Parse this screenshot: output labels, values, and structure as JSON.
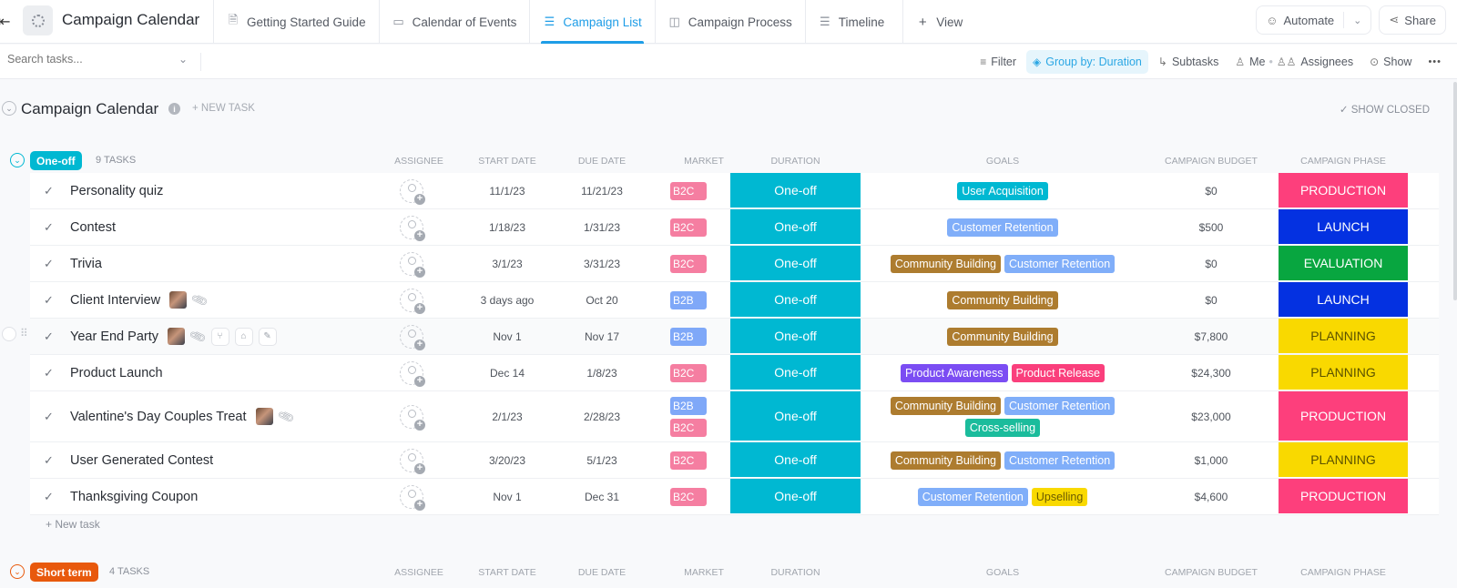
{
  "header": {
    "title": "Campaign Calendar",
    "tabs": [
      {
        "label": "Getting Started Guide",
        "icon": "doc-pin-icon",
        "active": false
      },
      {
        "label": "Calendar of Events",
        "icon": "calendar-pin-icon",
        "active": false
      },
      {
        "label": "Campaign List",
        "icon": "list-icon",
        "active": true
      },
      {
        "label": "Campaign Process",
        "icon": "board-icon",
        "active": false
      },
      {
        "label": "Timeline",
        "icon": "timeline-icon",
        "active": false
      }
    ],
    "add_view_label": "View",
    "automate_label": "Automate",
    "share_label": "Share"
  },
  "toolbar": {
    "search_placeholder": "Search tasks...",
    "filter_label": "Filter",
    "group_by_label": "Group by: Duration",
    "subtasks_label": "Subtasks",
    "me_label": "Me",
    "assignees_label": "Assignees",
    "show_label": "Show",
    "more_label": "•••"
  },
  "list": {
    "title": "Campaign Calendar",
    "new_task_label": "+ NEW TASK",
    "show_closed_label": "SHOW CLOSED"
  },
  "columns": {
    "assignee": "ASSIGNEE",
    "start_date": "START DATE",
    "due_date": "DUE DATE",
    "market": "MARKET",
    "duration": "DURATION",
    "goals": "GOALS",
    "budget": "CAMPAIGN BUDGET",
    "phase": "CAMPAIGN PHASE"
  },
  "colors": {
    "one_off": "#00b8d2",
    "short_term": "#e8590c",
    "b2c": "#f57ea1",
    "b2b": "#7fa8f8",
    "production": "#fd3f7c",
    "launch": "#0431e1",
    "evaluation": "#08a640",
    "planning": "#f9d900",
    "community_building": "#ad7c2f",
    "customer_retention": "#80aef9",
    "user_acquisition": "#00b8d2",
    "cross_selling": "#1bbc9c",
    "product_awareness": "#7b4df3",
    "product_release": "#fa3f7c",
    "upselling": "#f9d900"
  },
  "groups": [
    {
      "name": "One-off",
      "count_label": "9 TASKS",
      "new_task_label": "+ New task",
      "tasks": [
        {
          "name": "Personality quiz",
          "start": "11/1/23",
          "due": "11/21/23",
          "market": [
            "B2C"
          ],
          "duration": "One-off",
          "goals": [
            "User Acquisition"
          ],
          "budget": "$0",
          "phase": "PRODUCTION"
        },
        {
          "name": "Contest",
          "start": "1/18/23",
          "due": "1/31/23",
          "market": [
            "B2C"
          ],
          "duration": "One-off",
          "goals": [
            "Customer Retention"
          ],
          "budget": "$500",
          "phase": "LAUNCH"
        },
        {
          "name": "Trivia",
          "start": "3/1/23",
          "due": "3/31/23",
          "market": [
            "B2C"
          ],
          "duration": "One-off",
          "goals": [
            "Community Building",
            "Customer Retention"
          ],
          "budget": "$0",
          "phase": "EVALUATION"
        },
        {
          "name": "Client Interview",
          "start": "3 days ago",
          "due": "Oct 20",
          "market": [
            "B2B"
          ],
          "duration": "One-off",
          "goals": [
            "Community Building"
          ],
          "budget": "$0",
          "phase": "LAUNCH",
          "has_image": true,
          "has_attachment": true
        },
        {
          "name": "Year End Party",
          "start": "Nov 1",
          "due": "Nov 17",
          "market": [
            "B2B"
          ],
          "duration": "One-off",
          "goals": [
            "Community Building"
          ],
          "budget": "$7,800",
          "phase": "PLANNING",
          "has_image": true,
          "has_attachment": true,
          "hovered": true
        },
        {
          "name": "Product Launch",
          "start": "Dec 14",
          "due": "1/8/23",
          "market": [
            "B2C"
          ],
          "duration": "One-off",
          "goals": [
            "Product Awareness",
            "Product Release"
          ],
          "budget": "$24,300",
          "phase": "PLANNING"
        },
        {
          "name": "Valentine's Day Couples Treat",
          "start": "2/1/23",
          "due": "2/28/23",
          "market": [
            "B2B",
            "B2C"
          ],
          "duration": "One-off",
          "goals": [
            "Community Building",
            "Customer Retention",
            "Cross-selling"
          ],
          "budget": "$23,000",
          "phase": "PRODUCTION",
          "has_image": true,
          "has_attachment": true
        },
        {
          "name": "User Generated Contest",
          "start": "3/20/23",
          "due": "5/1/23",
          "market": [
            "B2C"
          ],
          "duration": "One-off",
          "goals": [
            "Community Building",
            "Customer Retention"
          ],
          "budget": "$1,000",
          "phase": "PLANNING"
        },
        {
          "name": "Thanksgiving Coupon",
          "start": "Nov 1",
          "due": "Dec 31",
          "market": [
            "B2C"
          ],
          "duration": "One-off",
          "goals": [
            "Customer Retention",
            "Upselling"
          ],
          "budget": "$4,600",
          "phase": "PRODUCTION"
        }
      ]
    },
    {
      "name": "Short term",
      "count_label": "4 TASKS"
    }
  ]
}
